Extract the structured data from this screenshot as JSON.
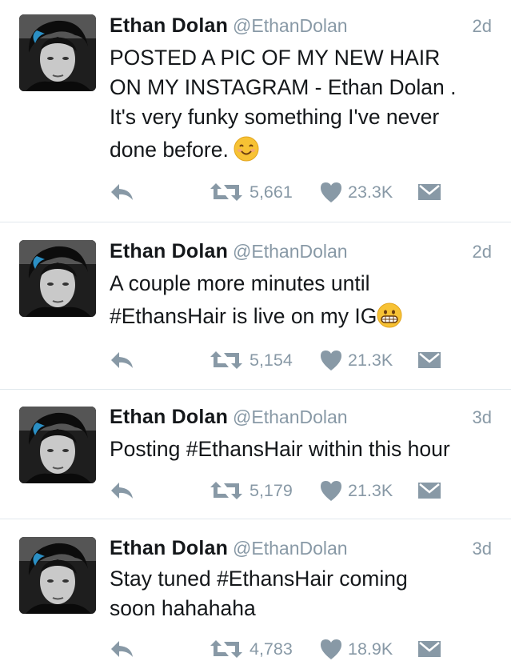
{
  "tweets": [
    {
      "name": "Ethan Dolan",
      "handle": "@EthanDolan",
      "time": "2d",
      "lines": [
        "POSTED A PIC OF MY NEW HAIR",
        "ON MY INSTAGRAM - Ethan Dolan .",
        "It's very funky something I've never",
        "done before."
      ],
      "emoji": "smiling-face-icon",
      "retweets": "5,661",
      "likes": "23.3K"
    },
    {
      "name": "Ethan Dolan",
      "handle": "@EthanDolan",
      "time": "2d",
      "lines": [
        "A couple more minutes until",
        "#EthansHair is live on my IG"
      ],
      "emoji": "grimacing-face-icon",
      "retweets": "5,154",
      "likes": "21.3K"
    },
    {
      "name": "Ethan Dolan",
      "handle": "@EthanDolan",
      "time": "3d",
      "lines": [
        "Posting #EthansHair within this hour"
      ],
      "emoji": "",
      "retweets": "5,179",
      "likes": "21.3K"
    },
    {
      "name": "Ethan Dolan",
      "handle": "@EthanDolan",
      "time": "3d",
      "lines": [
        "Stay tuned #EthansHair coming",
        "soon hahahaha"
      ],
      "emoji": "",
      "retweets": "4,783",
      "likes": "18.9K"
    }
  ],
  "colors": {
    "text": "#14171a",
    "muted": "#8899a6",
    "divider": "#e1e8ed",
    "emoji_yellow": "#f7c234"
  }
}
